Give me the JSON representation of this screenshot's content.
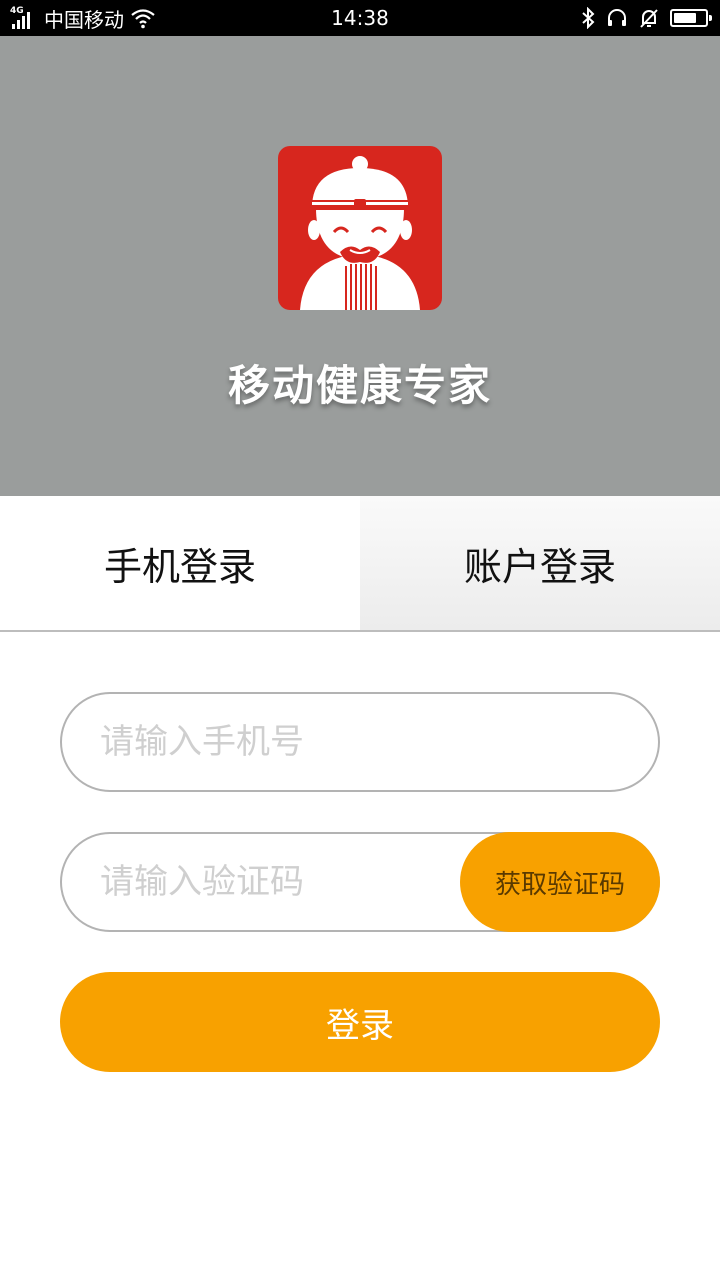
{
  "status_bar": {
    "network_type": "4G",
    "carrier": "中国移动",
    "time": "14:38",
    "icons": [
      "signal-icon",
      "wifi-icon",
      "bluetooth-icon",
      "headset-icon",
      "bell-muted-icon",
      "battery-icon"
    ],
    "battery_level": 0.75
  },
  "header": {
    "app_title": "移动健康专家",
    "logo_icon": "doctor-mascot-logo",
    "logo_color": "#d7261e",
    "background": "#9a9d9c"
  },
  "tabs": [
    {
      "label": "手机登录",
      "active": true
    },
    {
      "label": "账户登录",
      "active": false
    }
  ],
  "form": {
    "phone_placeholder": "请输入手机号",
    "code_placeholder": "请输入验证码",
    "get_code_label": "获取验证码",
    "login_label": "登录",
    "accent_color": "#f8a100"
  }
}
